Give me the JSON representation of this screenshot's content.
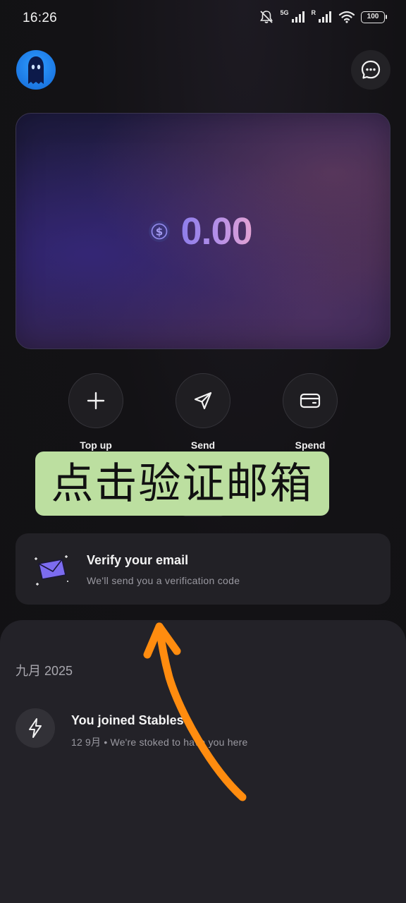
{
  "status_bar": {
    "time": "16:26",
    "network_1": "5G",
    "network_2": "R",
    "battery": "100"
  },
  "header": {
    "avatar_icon": "ghost-avatar-icon",
    "chat_icon": "chat-bubble-icon"
  },
  "balance": {
    "currency_icon": "usdc-dollar-icon",
    "amount": "0.00"
  },
  "actions": [
    {
      "label": "Top up",
      "icon": "plus-icon"
    },
    {
      "label": "Send",
      "icon": "paper-plane-icon"
    },
    {
      "label": "Spend",
      "icon": "card-icon"
    }
  ],
  "overlay": {
    "text": "点击验证邮箱",
    "color": "#bcdfa0",
    "arrow_color": "#ff8c0f"
  },
  "verify_card": {
    "title": "Verify your email",
    "subtitle": "We'll send you a verification code",
    "icon": "envelope-icon"
  },
  "activity": {
    "date_header": "九月 2025",
    "items": [
      {
        "title": "You joined Stables",
        "subtitle": "12 9月 • We're stoked to have you here",
        "icon": "lightning-icon"
      }
    ]
  },
  "colors": {
    "background": "#121114",
    "card": "#222126",
    "balance_gradient_start": "#8d7dea",
    "balance_gradient_end": "#e3a3d3"
  }
}
